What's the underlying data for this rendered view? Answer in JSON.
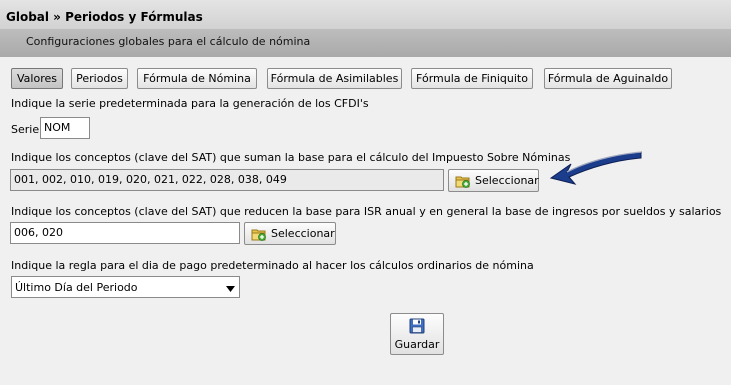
{
  "header": {
    "title": "Global » Periodos y Fórmulas",
    "subtitle": "Configuraciones globales para el cálculo de nómina"
  },
  "tabs": [
    {
      "label": "Valores",
      "active": true
    },
    {
      "label": "Periodos",
      "active": false
    },
    {
      "label": "Fórmula de Nómina",
      "active": false
    },
    {
      "label": "Fórmula de Asimilables",
      "active": false
    },
    {
      "label": "Fórmula de Finiquito",
      "active": false
    },
    {
      "label": "Fórmula de Aguinaldo",
      "active": false
    }
  ],
  "serie": {
    "description": "Indique la serie predeterminada para la generación de los CFDI's",
    "label": "Serie",
    "value": "NOM"
  },
  "isn": {
    "description": "Indique los conceptos (clave del SAT) que suman la base para el cálculo del Impuesto Sobre Nóminas",
    "value": "001, 002, 010, 019, 020, 021, 022, 028, 038, 049",
    "button_label": "Seleccionar"
  },
  "isr": {
    "description": "Indique los conceptos (clave del SAT) que reducen la base para ISR anual y en general la base de ingresos por sueldos y salarios",
    "value": "006, 020",
    "button_label": "Seleccionar"
  },
  "pay_rule": {
    "description": "Indique la regla para el dia de pago predeterminado al hacer los cálculos ordinarios de nómina",
    "selected": "Último Día del Periodo"
  },
  "save_label": "Guardar",
  "icons": {
    "select_button": "folder-add-icon",
    "save_button": "floppy-disk-icon",
    "annotation": "arrow-pointer-icon",
    "dropdown": "chevron-down-icon"
  },
  "colors": {
    "annotation_arrow": "#1c3d8c",
    "subtitle_bar": "#b3b3b3"
  }
}
